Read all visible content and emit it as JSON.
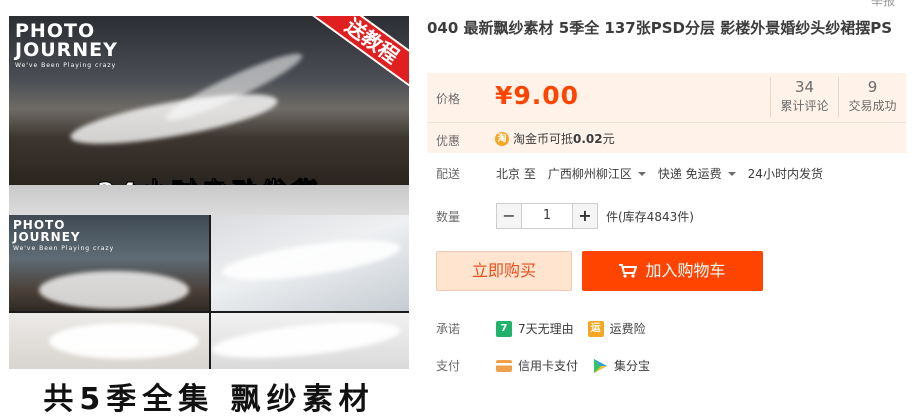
{
  "corner_link": "举报",
  "title": "040 最新飘纱素材 5季全 137张PSD分层 影楼外景婚纱头纱裙摆PS",
  "gallery": {
    "logo_main_1": "PHOTO",
    "logo_main_2": "JOURNEY",
    "logo_sub": "We've Been Playing crazy",
    "promo_badge": "送教程",
    "banner": "24小时自动发货",
    "footer": "共5季全集 飘纱素材"
  },
  "price": {
    "label": "价格",
    "value": "¥9.00",
    "reviews_count": "34",
    "reviews_label": "累计评论",
    "sales_count": "9",
    "sales_label": "交易成功"
  },
  "discount": {
    "label": "优惠",
    "icon": "taobao-coin-icon",
    "icon_char": "淘",
    "text_prefix": "淘金币可抵",
    "amount": "0.02",
    "unit": "元"
  },
  "shipping": {
    "label": "配送",
    "from": "北京 至",
    "to": "广西柳州柳江区",
    "method": "快递 免运费",
    "time": "24小时内发货"
  },
  "quantity": {
    "label": "数量",
    "value": "1",
    "minus": "−",
    "plus": "+",
    "stock": "件(库存4843件)"
  },
  "buttons": {
    "buy_now": "立即购买",
    "add_to_cart": "加入购物车"
  },
  "promise": {
    "label": "承诺",
    "items": [
      {
        "icon_char": "7",
        "text": "7天无理由",
        "color": "#21b36b"
      },
      {
        "icon_char": "运",
        "text": "运费险",
        "color": "#f5a623"
      }
    ]
  },
  "payment": {
    "label": "支付",
    "items": [
      {
        "icon": "credit-card-icon",
        "text": "信用卡支付",
        "color": "#f0a04b"
      },
      {
        "icon": "jifenbao-icon",
        "text": "集分宝",
        "color": "#2f9be9"
      }
    ]
  },
  "colors": {
    "accent": "#ff4400",
    "price_bg": "#fff2e8",
    "buy_bg": "#ffe4d0"
  }
}
